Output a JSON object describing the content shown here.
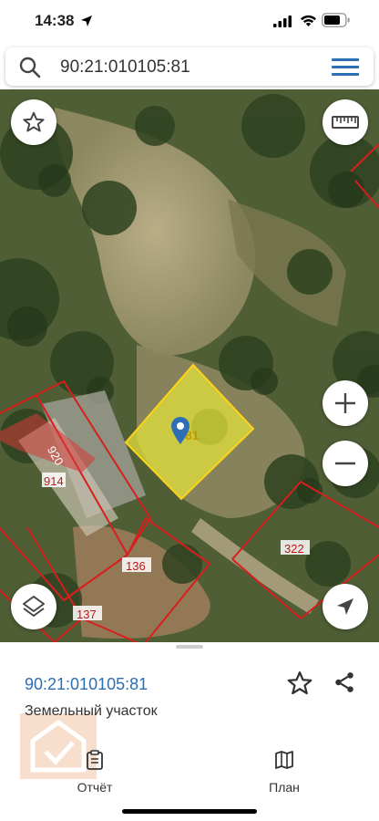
{
  "status_bar": {
    "time": "14:38"
  },
  "search": {
    "query": "90:21:010105:81"
  },
  "map": {
    "selected_parcel_label": "81",
    "parcel_labels": [
      "920",
      "914",
      "136",
      "137",
      "322"
    ],
    "selected_fill": "#e3e23a",
    "boundary_color": "#d81e1e",
    "marker_color": "#2d6fb5"
  },
  "sheet": {
    "cadastral_number": "90:21:010105:81",
    "property_type": "Земельный участок",
    "tabs": [
      {
        "label": "Отчёт",
        "icon": "clipboard-icon"
      },
      {
        "label": "План",
        "icon": "map-icon"
      }
    ]
  }
}
